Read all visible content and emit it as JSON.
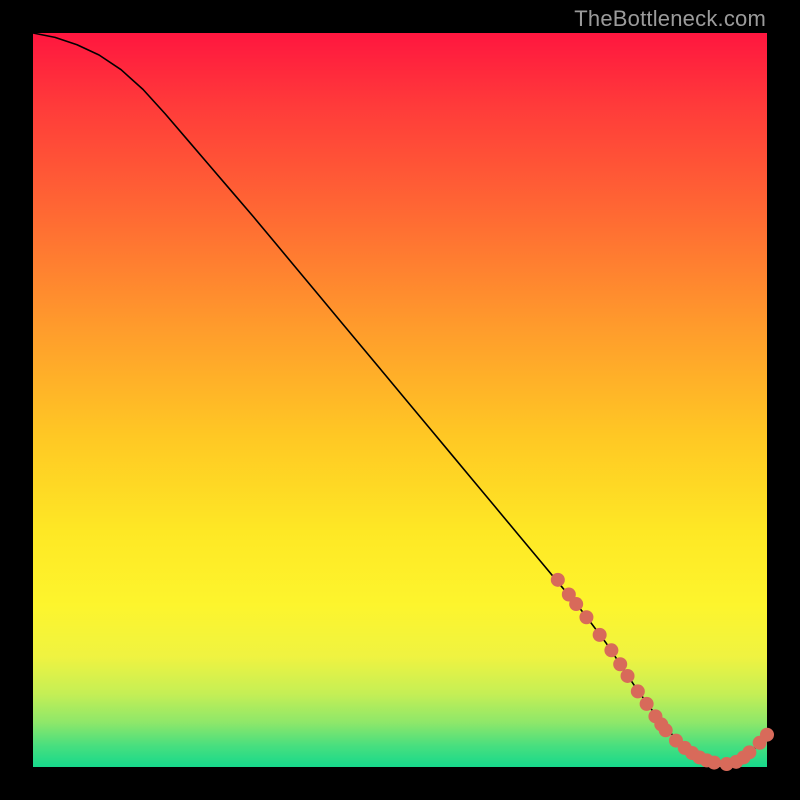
{
  "watermark": "TheBottleneck.com",
  "colors": {
    "dot": "#d86a5a",
    "curve": "#000000"
  },
  "chart_data": {
    "type": "line",
    "title": "",
    "xlabel": "",
    "ylabel": "",
    "xlim": [
      0,
      100
    ],
    "ylim": [
      0,
      100
    ],
    "grid": false,
    "legend": false,
    "series": [
      {
        "name": "bottleneck-curve",
        "x": [
          0,
          3,
          6,
          9,
          12,
          15,
          18,
          21,
          24,
          27,
          30,
          33,
          36,
          39,
          42,
          45,
          48,
          51,
          54,
          57,
          60,
          63,
          66,
          69,
          72,
          75,
          78,
          80,
          82,
          84,
          86,
          88,
          90,
          92,
          94,
          96,
          98,
          100
        ],
        "y": [
          100,
          99.4,
          98.4,
          97.0,
          95.0,
          92.3,
          89.0,
          85.5,
          82.0,
          78.5,
          75.0,
          71.4,
          67.8,
          64.2,
          60.6,
          57.0,
          53.4,
          49.8,
          46.2,
          42.6,
          39.0,
          35.4,
          31.8,
          28.2,
          24.6,
          21.0,
          17.0,
          14.0,
          11.0,
          8.2,
          5.6,
          3.4,
          1.8,
          0.9,
          0.4,
          0.9,
          2.2,
          4.4
        ]
      }
    ],
    "scatter_points": {
      "name": "data-points",
      "points": [
        {
          "x": 71.5,
          "y": 25.5
        },
        {
          "x": 73.0,
          "y": 23.5
        },
        {
          "x": 74.0,
          "y": 22.2
        },
        {
          "x": 75.4,
          "y": 20.4
        },
        {
          "x": 77.2,
          "y": 18.0
        },
        {
          "x": 78.8,
          "y": 15.9
        },
        {
          "x": 80.0,
          "y": 14.0
        },
        {
          "x": 81.0,
          "y": 12.4
        },
        {
          "x": 82.4,
          "y": 10.3
        },
        {
          "x": 83.6,
          "y": 8.6
        },
        {
          "x": 84.8,
          "y": 6.9
        },
        {
          "x": 85.6,
          "y": 5.8
        },
        {
          "x": 86.2,
          "y": 5.0
        },
        {
          "x": 87.6,
          "y": 3.6
        },
        {
          "x": 88.8,
          "y": 2.6
        },
        {
          "x": 89.8,
          "y": 1.9
        },
        {
          "x": 90.8,
          "y": 1.3
        },
        {
          "x": 91.8,
          "y": 0.9
        },
        {
          "x": 92.8,
          "y": 0.6
        },
        {
          "x": 94.5,
          "y": 0.4
        },
        {
          "x": 95.8,
          "y": 0.7
        },
        {
          "x": 96.8,
          "y": 1.3
        },
        {
          "x": 97.6,
          "y": 2.0
        },
        {
          "x": 99.0,
          "y": 3.3
        },
        {
          "x": 100.0,
          "y": 4.4
        }
      ]
    }
  }
}
